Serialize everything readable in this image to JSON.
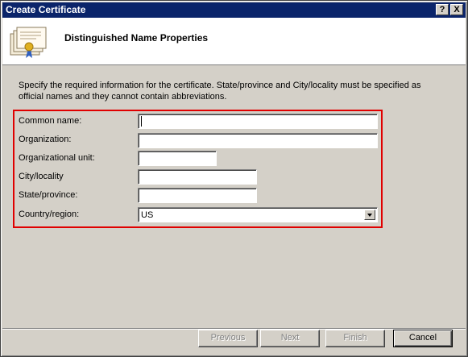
{
  "window": {
    "title": "Create Certificate",
    "help_label": "?",
    "close_label": "X"
  },
  "header": {
    "title": "Distinguished Name Properties",
    "icon": "certificate-icon"
  },
  "intro": "Specify the required information for the certificate. State/province and City/locality must be specified as official names and they cannot contain abbreviations.",
  "form": {
    "common_name": {
      "label": "Common name:",
      "value": ""
    },
    "organization": {
      "label": "Organization:",
      "value": ""
    },
    "organizational_unit": {
      "label": "Organizational unit:",
      "value": ""
    },
    "city": {
      "label": "City/locality",
      "value": ""
    },
    "state": {
      "label": "State/province:",
      "value": ""
    },
    "country": {
      "label": "Country/region:",
      "value": "US"
    }
  },
  "buttons": {
    "previous": "Previous",
    "next": "Next",
    "finish": "Finish",
    "cancel": "Cancel"
  },
  "colors": {
    "title_bar": "#0a246a",
    "highlight_border": "#e00000",
    "dialog_bg": "#d4d0c8"
  }
}
